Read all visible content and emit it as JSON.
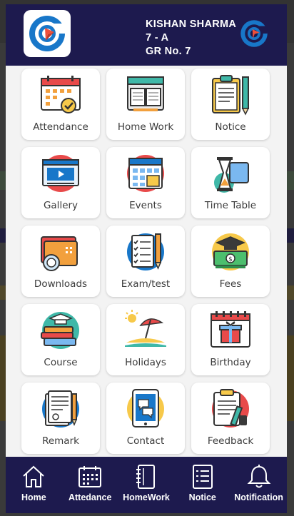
{
  "header": {
    "student_name": "KISHAN SHARMA",
    "class": "7 - A",
    "gr_number": "GR No. 7"
  },
  "modules": [
    {
      "label": "Attendance",
      "icon": "calendar-check-icon"
    },
    {
      "label": "Home Work",
      "icon": "open-book-icon"
    },
    {
      "label": "Notice",
      "icon": "clipboard-pen-icon"
    },
    {
      "label": "Gallery",
      "icon": "video-player-icon"
    },
    {
      "label": "Events",
      "icon": "calendar-icon"
    },
    {
      "label": "Time Table",
      "icon": "hourglass-icon"
    },
    {
      "label": "Downloads",
      "icon": "folder-icon"
    },
    {
      "label": "Exam/test",
      "icon": "checklist-icon"
    },
    {
      "label": "Fees",
      "icon": "money-cap-icon"
    },
    {
      "label": "Course",
      "icon": "books-cap-icon"
    },
    {
      "label": "Holidays",
      "icon": "beach-umbrella-icon"
    },
    {
      "label": "Birthday",
      "icon": "gift-calendar-icon"
    },
    {
      "label": "Remark",
      "icon": "document-pencil-icon"
    },
    {
      "label": "Contact",
      "icon": "tablet-chat-icon"
    },
    {
      "label": "Feedback",
      "icon": "feedback-form-icon"
    }
  ],
  "nav": [
    {
      "label": "Home",
      "icon": "home-icon"
    },
    {
      "label": "Attedance",
      "icon": "calendar-grid-icon"
    },
    {
      "label": "HomeWork",
      "icon": "notebook-icon"
    },
    {
      "label": "Notice",
      "icon": "notice-list-icon"
    },
    {
      "label": "Notification",
      "icon": "bell-icon"
    }
  ],
  "colors": {
    "header_bg": "#1d1a4e",
    "panel_bg": "#f3f3f3",
    "tile_bg": "#ffffff",
    "label_text": "#3b3b3b"
  }
}
